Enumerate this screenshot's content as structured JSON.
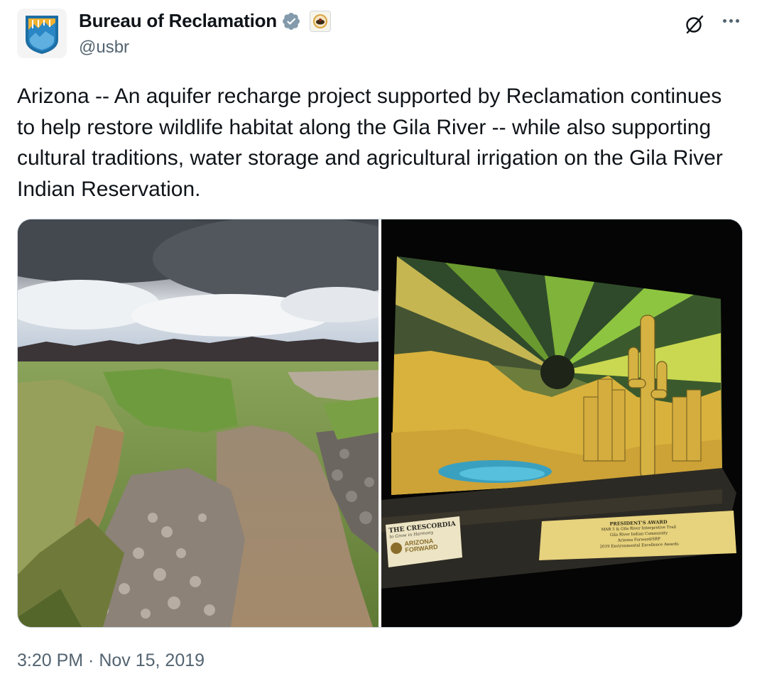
{
  "author": {
    "name": "Bureau of Reclamation",
    "handle": "@usbr",
    "avatar_icon": "usbr-logo-icon",
    "verified_icon": "verified-badge-icon",
    "affiliate_icon": "doi-seal-icon"
  },
  "header_actions": {
    "grok_icon": "grok-icon",
    "more_icon": "more-options-icon"
  },
  "tweet": {
    "text": "Arizona -- An aquifer recharge project supported by Reclamation continues to help restore wildlife habitat along the Gila River -- while also supporting cultural traditions, water storage and agricultural irrigation on the Gila River Indian Reservation."
  },
  "media": {
    "photos": [
      {
        "subject": "gila-river-landscape"
      },
      {
        "subject": "award-plaque",
        "left_card": {
          "title": "THE CRESCORDIA",
          "subtitle": "to Grow in Harmony",
          "logo_line1": "ARIZONA",
          "logo_line2": "FORWARD"
        },
        "right_card": {
          "title": "PRESIDENT'S AWARD",
          "line1": "MAR 5 & Gila River Interpretive Trail",
          "line2": "Gila River Indian Community",
          "line3": "Arizona Forward/SRP",
          "line4": "2019 Environmental Excellence Awards"
        }
      }
    ]
  },
  "timestamp": "3:20 PM · Nov 15, 2019",
  "colors": {
    "text": "#0f1419",
    "secondary": "#536471",
    "verified": "#829aab",
    "border": "#cfd9de"
  }
}
